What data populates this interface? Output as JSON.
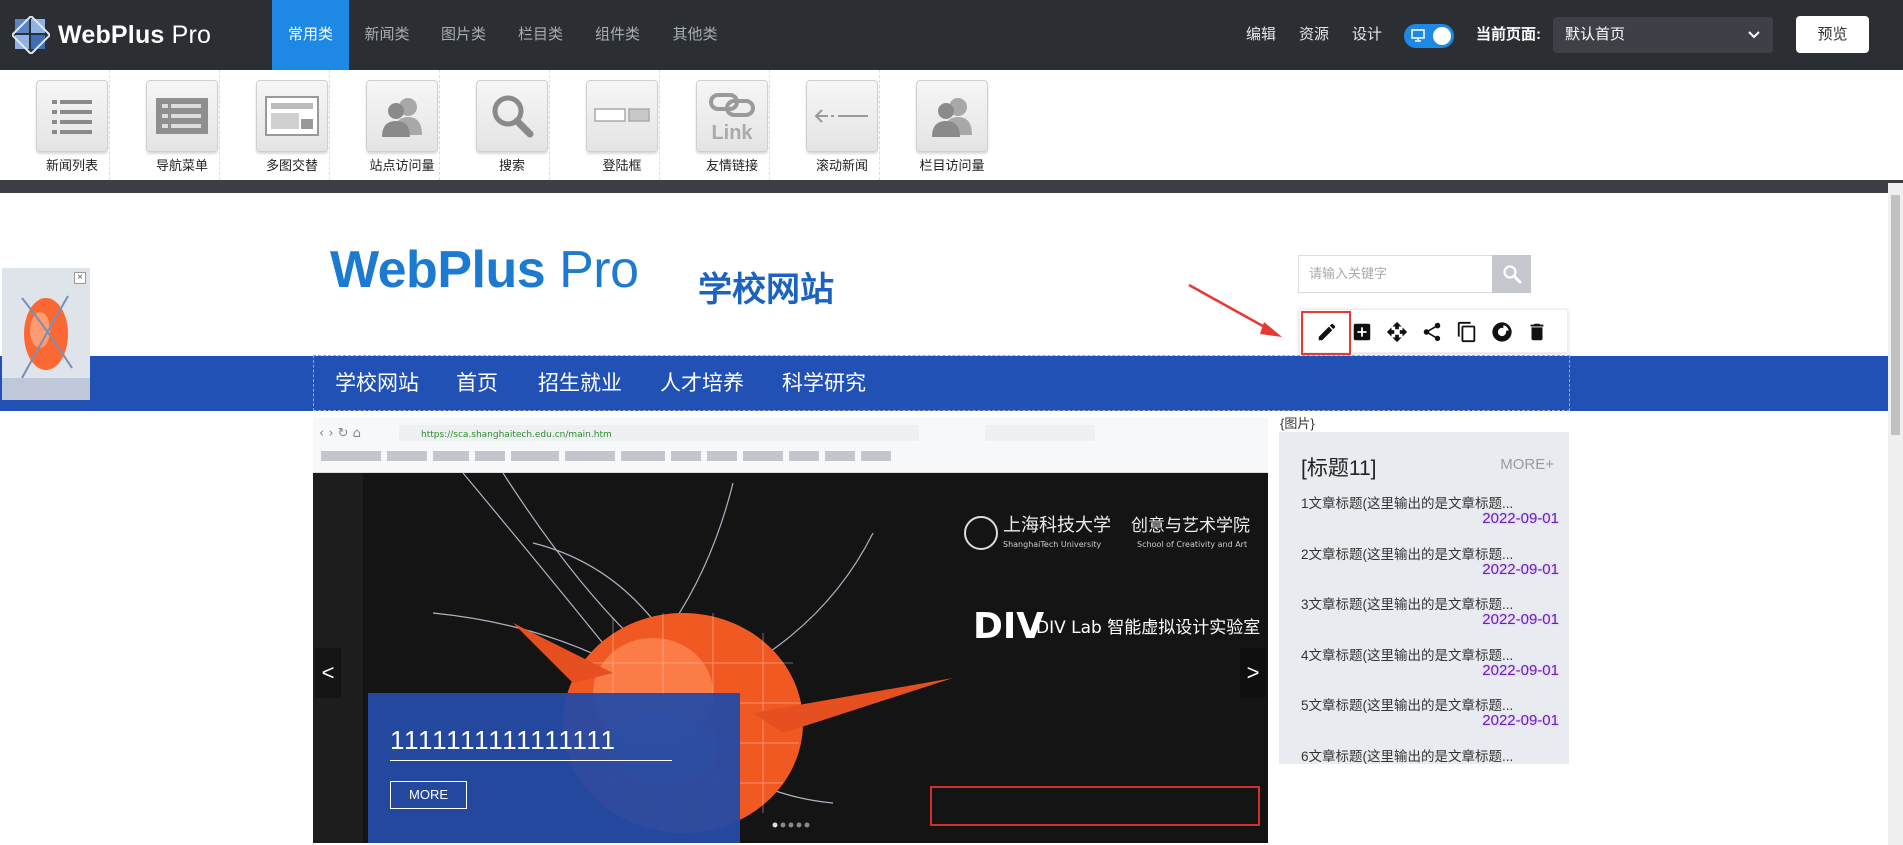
{
  "app": {
    "logo_text": "WebPlus",
    "logo_suffix": " Pro"
  },
  "tabs": [
    {
      "label": "常用类",
      "active": true
    },
    {
      "label": "新闻类"
    },
    {
      "label": "图片类"
    },
    {
      "label": "栏目类"
    },
    {
      "label": "组件类"
    },
    {
      "label": "其他类"
    }
  ],
  "toolbar": {
    "edit": "编辑",
    "resources": "资源",
    "design": "设计",
    "current_page_label": "当前页面:",
    "current_page_value": "默认首页",
    "preview": "预览"
  },
  "components": [
    {
      "label": "新闻列表",
      "icon": "news-list-icon"
    },
    {
      "label": "导航菜单",
      "icon": "nav-menu-icon"
    },
    {
      "label": "多图交替",
      "icon": "multi-image-icon"
    },
    {
      "label": "站点访问量",
      "icon": "users-icon"
    },
    {
      "label": "搜索",
      "icon": "search-icon"
    },
    {
      "label": "登陆框",
      "icon": "login-box-icon"
    },
    {
      "label": "友情链接",
      "icon": "link-icon"
    },
    {
      "label": "滚动新闻",
      "icon": "scroll-news-icon"
    },
    {
      "label": "栏目访问量",
      "icon": "users-icon"
    }
  ],
  "site": {
    "logo_text": "WebPlus",
    "logo_suffix": " Pro",
    "name": "学校网站",
    "search_placeholder": "请输入关键字",
    "nav": [
      "学校网站",
      "首页",
      "招生就业",
      "人才培养",
      "科学研究"
    ]
  },
  "edit_tools": [
    "pencil-icon",
    "add-box-icon",
    "move-icon",
    "share-icon",
    "copy-icon",
    "refresh-icon",
    "delete-icon"
  ],
  "banner": {
    "url": "https://sca.shanghaitech.edu.cn/main.htm",
    "caption_title": "1111111111111111",
    "caption_more": "MORE",
    "prev": "<",
    "next": ">",
    "overlay_univ_cn": "上海科技大学",
    "overlay_univ_en": "ShanghaiTech University",
    "overlay_school_cn": "创意与艺术学院",
    "overlay_school_en": "School of Creativity and Art",
    "overlay_lab": "DIV Lab 智能虚拟设计实验室",
    "overlay_div": "DIV"
  },
  "panel": {
    "pic_label": "{图片}",
    "title": "[标题11]",
    "more": "MORE+",
    "items": [
      {
        "text": "1文章标题(这里输出的是文章标题...",
        "date": "2022-09-01"
      },
      {
        "text": "2文章标题(这里输出的是文章标题...",
        "date": "2022-09-01"
      },
      {
        "text": "3文章标题(这里输出的是文章标题...",
        "date": "2022-09-01"
      },
      {
        "text": "4文章标题(这里输出的是文章标题...",
        "date": "2022-09-01"
      },
      {
        "text": "5文章标题(这里输出的是文章标题...",
        "date": "2022-09-01"
      },
      {
        "text": "6文章标题(这里输出的是文章标题...",
        "date": ""
      }
    ]
  },
  "colors": {
    "topbar": "#2b2e33",
    "accent": "#1e88e5",
    "site_nav": "#2151b4",
    "highlight": "#e53935"
  }
}
